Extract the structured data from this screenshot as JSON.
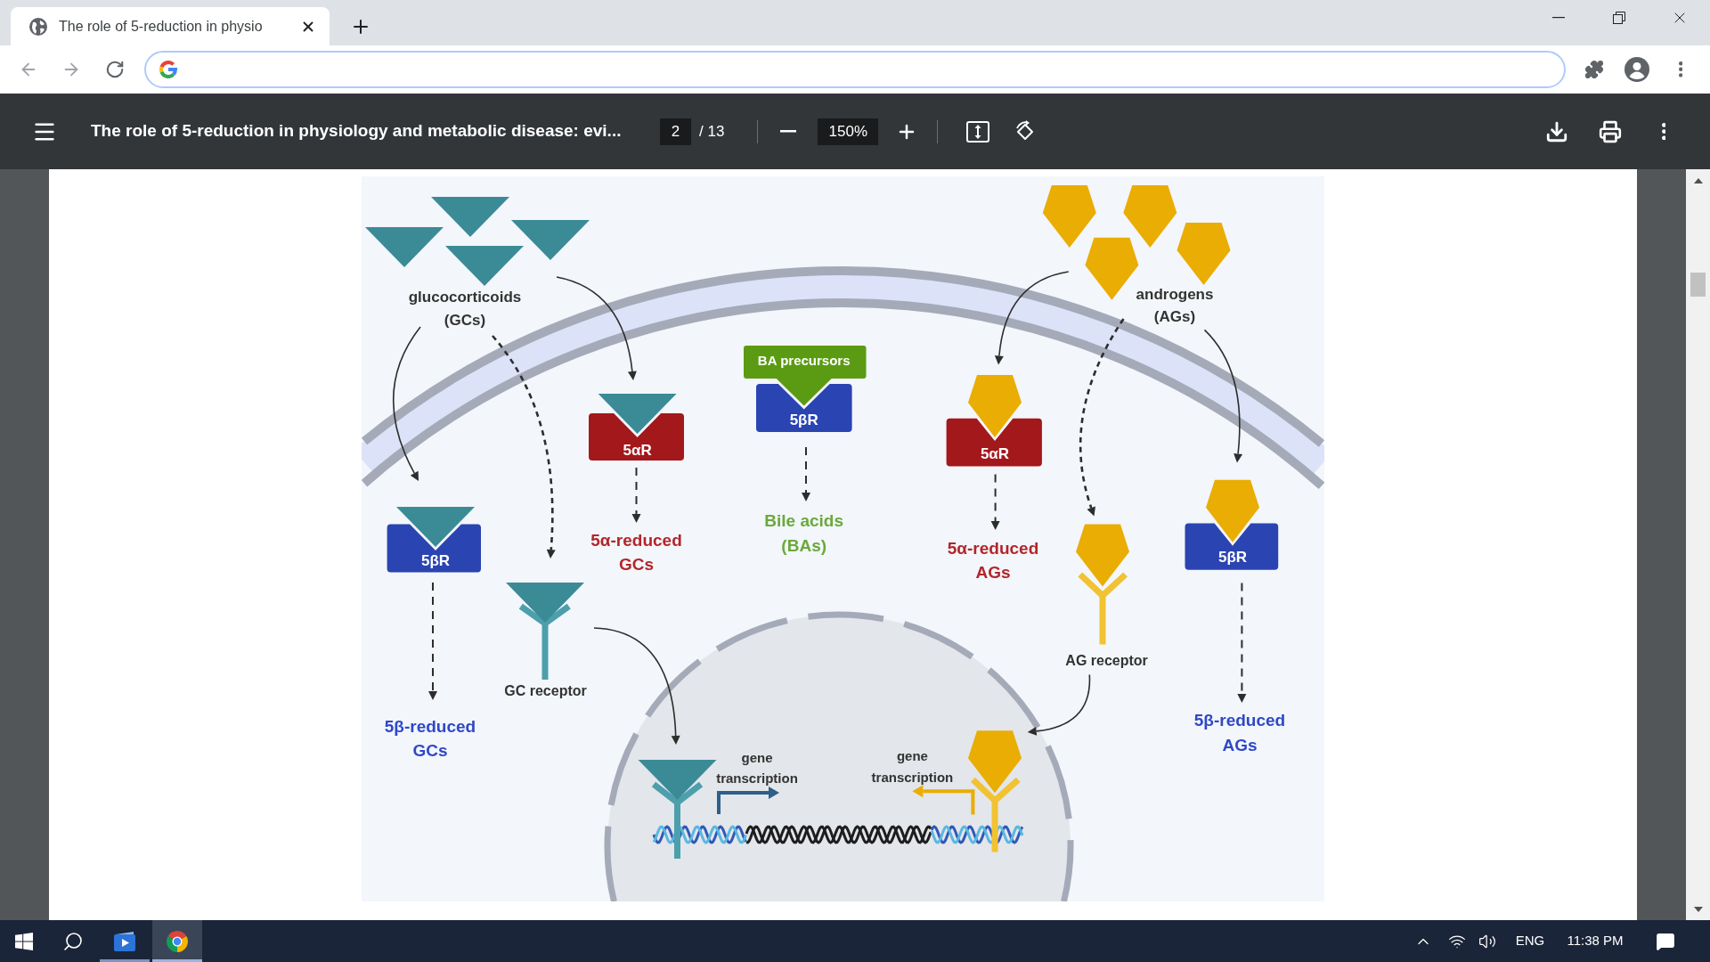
{
  "browser": {
    "tabs": [
      {
        "title": "The role of 5-reduction in physio",
        "selected": true
      }
    ]
  },
  "pdf_toolbar": {
    "title": "The role of 5-reduction in physiology and metabolic disease: evi...",
    "page": "2",
    "page_count": "/ 13",
    "zoom": "150%"
  },
  "figure": {
    "glucocorticoids": {
      "lines": [
        "glucocorticoids",
        "(GCs)"
      ]
    },
    "androgens": {
      "lines": [
        "androgens",
        "(AGs)"
      ]
    },
    "ba_precursors": "BA precursors",
    "enzymes": [
      {
        "label": "5βR",
        "color": "#2a44b2"
      },
      {
        "label": "5αR",
        "color": "#a3181b"
      },
      {
        "label": "5βR",
        "color": "#2a44b2"
      },
      {
        "label": "5αR",
        "color": "#a3181b"
      },
      {
        "label": "5βR",
        "color": "#2a44b2"
      }
    ],
    "products": [
      {
        "lines": [
          "5β-reduced",
          "GCs"
        ],
        "color": "#2f48c8"
      },
      {
        "lines": [
          "5α-reduced",
          "GCs"
        ],
        "color": "#b3262a"
      },
      {
        "lines": [
          "Bile acids",
          "(BAs)"
        ],
        "color": "#6aa93b"
      },
      {
        "lines": [
          "5α-reduced",
          "AGs"
        ],
        "color": "#b3262a"
      },
      {
        "lines": [
          "5β-reduced",
          "AGs"
        ],
        "color": "#2f48c8"
      }
    ],
    "receptors": [
      "GC receptor",
      "AG receptor"
    ],
    "gene_transcription": [
      {
        "lines": [
          "gene",
          "transcription"
        ]
      },
      {
        "lines": [
          "gene",
          "transcription"
        ]
      }
    ]
  },
  "taskbar": {
    "apps": [
      {
        "kind": "media",
        "selected": false
      },
      {
        "kind": "browser",
        "selected": true
      }
    ],
    "language": "ENG",
    "time": "11:38 PM"
  }
}
